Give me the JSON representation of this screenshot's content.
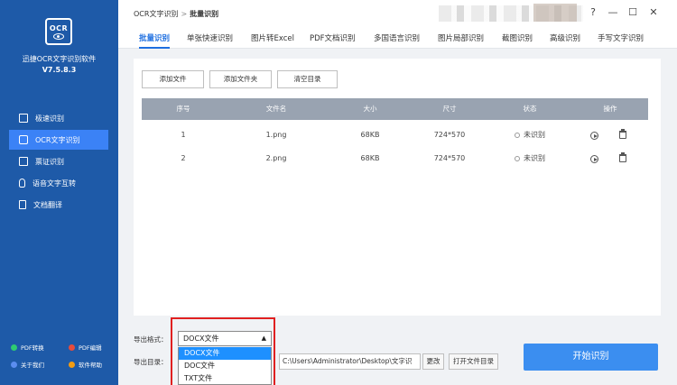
{
  "app": {
    "logo_text": "OCR",
    "name": "迅捷OCR文字识别软件",
    "version": "V7.5.8.3"
  },
  "sidebar": {
    "items": [
      {
        "label": "极速识别",
        "icon": "scan-icon",
        "active": false
      },
      {
        "label": "OCR文字识别",
        "icon": "ocr-icon",
        "active": true
      },
      {
        "label": "票证识别",
        "icon": "card-icon",
        "active": false
      },
      {
        "label": "语音文字互转",
        "icon": "microphone-icon",
        "active": false
      },
      {
        "label": "文档翻译",
        "icon": "document-icon",
        "active": false
      }
    ],
    "bottom_links": [
      {
        "label": "PDF转换",
        "color": "#2ecc71"
      },
      {
        "label": "PDF编辑",
        "color": "#e74c3c"
      },
      {
        "label": "关于我们",
        "color": "#5b8def"
      },
      {
        "label": "软件帮助",
        "color": "#f39c12"
      }
    ]
  },
  "header": {
    "breadcrumb_root": "OCR文字识别",
    "breadcrumb_sep": ">",
    "breadcrumb_current": "批量识别",
    "window_controls": [
      "?",
      "—",
      "☐",
      "✕"
    ]
  },
  "tabs": [
    {
      "label": "批量识别",
      "active": true
    },
    {
      "label": "单张快速识别"
    },
    {
      "label": "图片转Excel"
    },
    {
      "label": "PDF文档识别"
    },
    {
      "label": "多国语言识别"
    },
    {
      "label": "图片局部识别"
    },
    {
      "label": "截图识别"
    },
    {
      "label": "高级识别"
    },
    {
      "label": "手写文字识别"
    }
  ],
  "toolbar": {
    "add_file": "添加文件",
    "add_folder": "添加文件夹",
    "clear_list": "清空目录"
  },
  "table": {
    "columns": [
      "序号",
      "文件名",
      "大小",
      "尺寸",
      "状态",
      "操作"
    ],
    "rows": [
      {
        "index": "1",
        "filename": "1.png",
        "size": "68KB",
        "dimensions": "724*570",
        "status": "未识别"
      },
      {
        "index": "2",
        "filename": "2.png",
        "size": "68KB",
        "dimensions": "724*570",
        "status": "未识别"
      }
    ]
  },
  "output": {
    "format_label": "导出格式：",
    "format_selected": "DOCX文件",
    "format_options": [
      "DOCX文件",
      "DOC文件",
      "TXT文件"
    ],
    "dir_label": "导出目录：",
    "dir_path": "C:\\Users\\Administrator\\Desktop\\文字识",
    "change_label": "更改",
    "open_dir_label": "打开文件目录"
  },
  "start_button": "开始识别"
}
